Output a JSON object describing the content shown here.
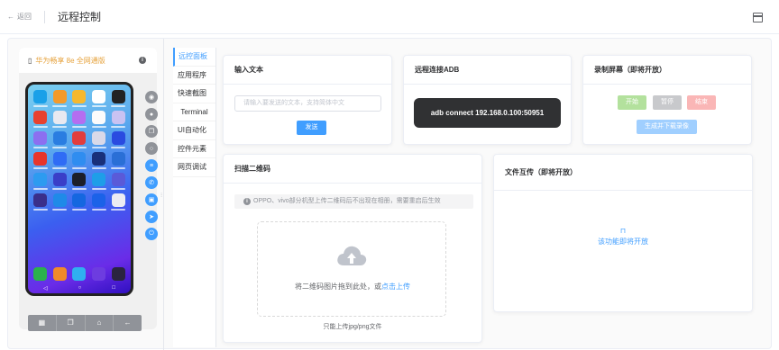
{
  "header": {
    "back_label": "返回",
    "page_title": "远程控制"
  },
  "device": {
    "name": "华为畅享 8e 全网通版"
  },
  "phone_footer": {
    "buttons": [
      "grid-icon",
      "copy-icon",
      "home-icon",
      "back-icon"
    ]
  },
  "side_buttons": [
    "eye-icon",
    "user-icon",
    "copy-icon",
    "search-icon",
    "sliders-icon",
    "phone-icon",
    "camera-icon",
    "send-icon",
    "power-icon"
  ],
  "menu": {
    "items": [
      "远控面板",
      "应用程序",
      "快速截图",
      "Terminal",
      "UI自动化",
      "控件元素",
      "网页调试"
    ],
    "active_index": 0
  },
  "cards": {
    "input_text": {
      "title": "输入文本",
      "placeholder": "请输入要发送的文本，支持简体中文",
      "send_label": "发送"
    },
    "adb": {
      "title": "远程连接ADB",
      "command": "adb connect 192.168.0.100:50951"
    },
    "record": {
      "title": "录制屏幕（即将开放）",
      "start": "开始",
      "pause": "暂停",
      "stop": "结束",
      "download": "生成并下载录像"
    },
    "qrcode": {
      "title": "扫描二维码",
      "notice": "OPPO、vivo部分机型上传二维码后不出现在相册，需要重启后生效",
      "upload_text": "将二维码图片拖到此处，或",
      "upload_link": "点击上传",
      "tip": "只能上传jpg/png文件"
    },
    "file_transfer": {
      "title": "文件互传（即将开放）",
      "coming_soon": "该功能即将开放"
    }
  },
  "colors": {
    "primary": "#409eff",
    "success": "#67c23a",
    "danger": "#f56c6c",
    "warning": "#e6a23c",
    "info": "#909399"
  }
}
